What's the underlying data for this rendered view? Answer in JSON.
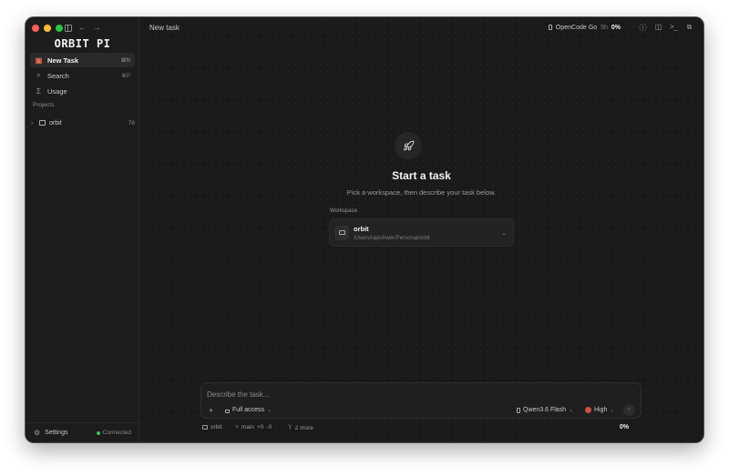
{
  "app": {
    "brand": "ORBIT PI"
  },
  "sidebar": {
    "nav": [
      {
        "label": "New Task",
        "shortcut": "⌘N",
        "icon": "new-task-icon"
      },
      {
        "label": "Search",
        "shortcut": "⌘P",
        "icon": "search-icon"
      },
      {
        "label": "Usage",
        "shortcut": "",
        "icon": "sigma-icon"
      }
    ],
    "projects_label": "Projects",
    "project": {
      "name": "orbit",
      "count": "78"
    },
    "settings_label": "Settings",
    "connection_status": "Connected"
  },
  "header": {
    "title": "New task",
    "provider": "OpenCode Go",
    "window": "5h",
    "usage_percent": "0%"
  },
  "hero": {
    "title": "Start a task",
    "subtitle": "Pick a workspace, then describe your task below."
  },
  "workspace": {
    "label": "Workspace",
    "name": "orbit",
    "path": "/Users/rajeshwer/Personal/orbit"
  },
  "composer": {
    "placeholder": "Describe the task...",
    "access": "Full access",
    "model": "Qwen3.6 Flash",
    "effort": "High"
  },
  "statusbar": {
    "project": "orbit",
    "branch": "main",
    "additions": "+0",
    "deletions": "-0",
    "worktrees": "2 more",
    "percent": "0%"
  },
  "colors": {
    "accent": "#e86a4a",
    "connected": "#34c759"
  }
}
